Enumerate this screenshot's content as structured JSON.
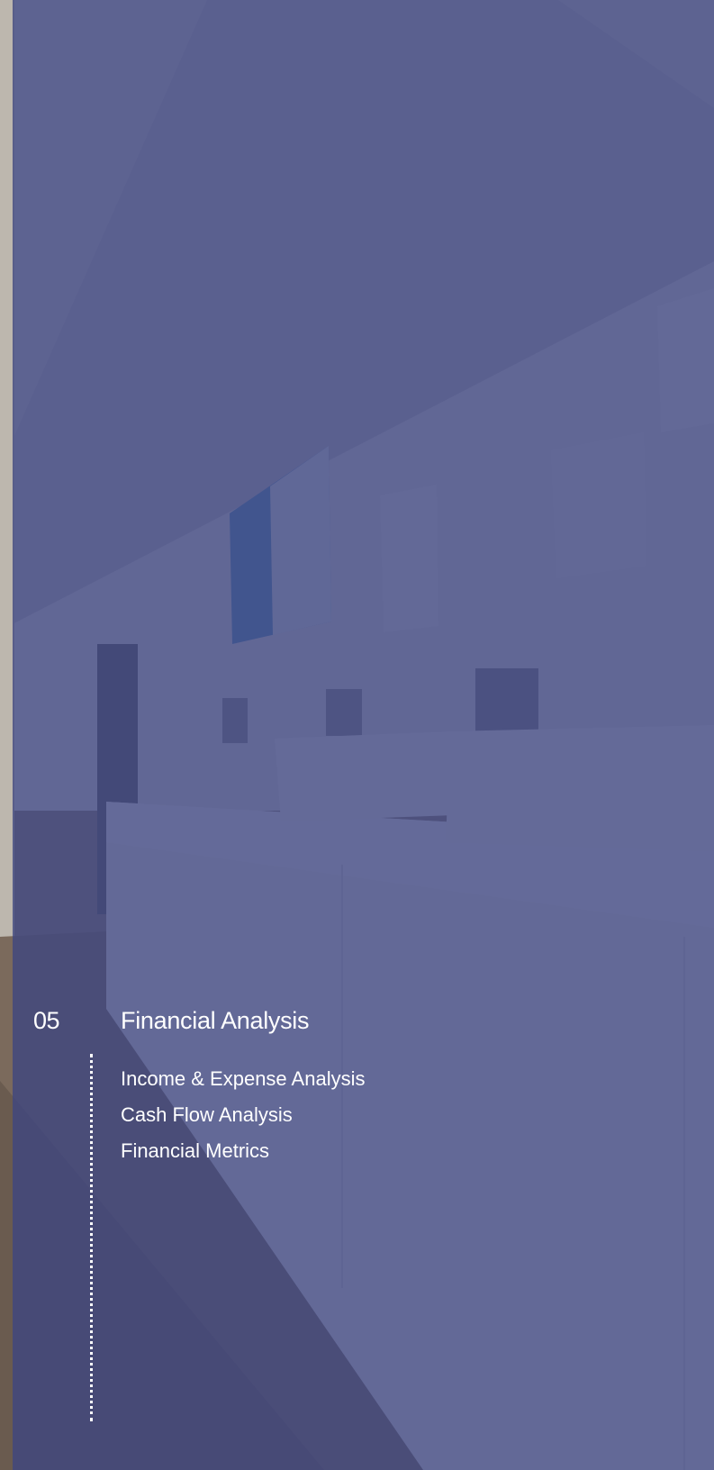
{
  "section": {
    "number": "05",
    "title": "Financial Analysis",
    "items": [
      {
        "label": "Income & Expense Analysis"
      },
      {
        "label": "Cash Flow Analysis"
      },
      {
        "label": "Financial Metrics"
      }
    ]
  },
  "colors": {
    "overlay": "#3e4680",
    "text": "#ffffff"
  }
}
